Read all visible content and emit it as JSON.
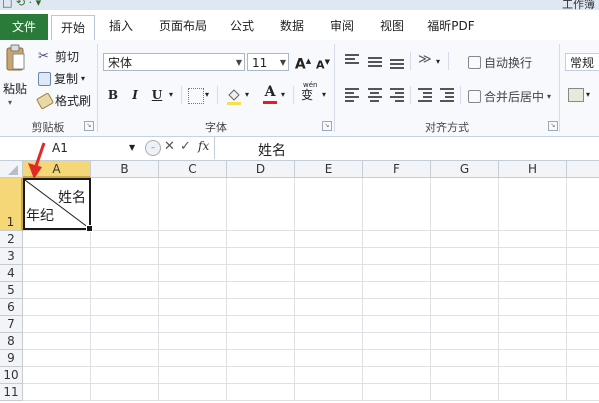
{
  "title_bar": {
    "quick_access": "□ ⟲ · ▾",
    "window_title": "工作簿"
  },
  "tabs": [
    "文件",
    "开始",
    "插入",
    "页面布局",
    "公式",
    "数据",
    "审阅",
    "视图",
    "福昕PDF"
  ],
  "clipboard": {
    "paste": "粘贴",
    "cut": "剪切",
    "copy": "复制",
    "format_painter": "格式刷",
    "group": "剪贴板"
  },
  "font": {
    "name": "宋体",
    "size": "11",
    "grow": "A",
    "shrink": "A",
    "bold": "B",
    "italic": "I",
    "underline": "U",
    "phonetic": "wén",
    "group": "字体"
  },
  "alignment": {
    "wrap_text": "自动换行",
    "merge_center": "合并后居中",
    "group": "对齐方式"
  },
  "number": {
    "format": "常规"
  },
  "formula_bar": {
    "name_box": "A1",
    "fx": "fx",
    "content": "姓名"
  },
  "columns": [
    "A",
    "B",
    "C",
    "D",
    "E",
    "F",
    "G",
    "H"
  ],
  "rows": [
    "1",
    "2",
    "3",
    "4",
    "5",
    "6",
    "7",
    "8",
    "9",
    "10",
    "11"
  ],
  "cell_a1": {
    "line1": "姓名",
    "line2": "年纪"
  },
  "colors": {
    "file_tab": "#2a7a3a",
    "selection_header": "#f6d777",
    "arrow": "#e02a2a",
    "font_color_bar": "#e02020"
  }
}
